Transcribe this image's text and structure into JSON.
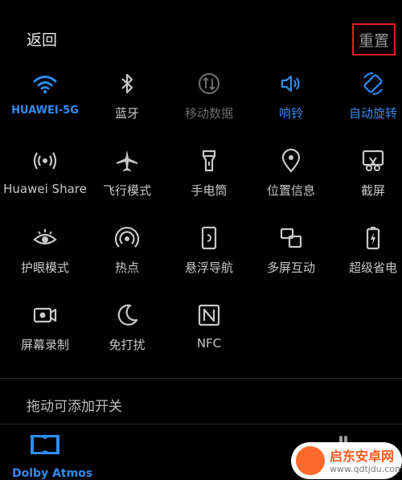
{
  "header": {
    "back_label": "返回",
    "reset_label": "重置"
  },
  "tiles": [
    {
      "label": "HUAWEI-5G",
      "icon": "wifi-icon",
      "state": "on"
    },
    {
      "label": "蓝牙",
      "icon": "bluetooth-icon",
      "state": "off"
    },
    {
      "label": "移动数据",
      "icon": "mobile-data-icon",
      "state": "disabled"
    },
    {
      "label": "响铃",
      "icon": "sound-icon",
      "state": "on"
    },
    {
      "label": "自动旋转",
      "icon": "auto-rotate-icon",
      "state": "on"
    },
    {
      "label": "Huawei Share",
      "icon": "huawei-share-icon",
      "state": "off"
    },
    {
      "label": "飞行模式",
      "icon": "airplane-icon",
      "state": "off"
    },
    {
      "label": "手电筒",
      "icon": "flashlight-icon",
      "state": "off"
    },
    {
      "label": "位置信息",
      "icon": "location-icon",
      "state": "off"
    },
    {
      "label": "截屏",
      "icon": "screenshot-icon",
      "state": "off"
    },
    {
      "label": "护眼模式",
      "icon": "eye-comfort-icon",
      "state": "off"
    },
    {
      "label": "热点",
      "icon": "hotspot-icon",
      "state": "off"
    },
    {
      "label": "悬浮导航",
      "icon": "floating-dock-icon",
      "state": "off"
    },
    {
      "label": "多屏互动",
      "icon": "multi-screen-icon",
      "state": "off"
    },
    {
      "label": "超级省电",
      "icon": "battery-saver-icon",
      "state": "off"
    },
    {
      "label": "屏幕录制",
      "icon": "screen-record-icon",
      "state": "off"
    },
    {
      "label": "免打扰",
      "icon": "do-not-disturb-icon",
      "state": "off"
    },
    {
      "label": "NFC",
      "icon": "nfc-icon",
      "state": "off"
    }
  ],
  "drag_section": {
    "title": "拖动可添加开关",
    "items": [
      {
        "label": "Dolby Atmos",
        "icon": "dolby-icon",
        "state": "on"
      }
    ]
  },
  "watermark": {
    "title": "启东安卓网",
    "url": "www.qdtjdu.com"
  },
  "colors": {
    "accent": "#2f8cf0",
    "text": "#c8c8c8",
    "disabled": "#6a6a6a",
    "highlight_box": "#e02020"
  }
}
